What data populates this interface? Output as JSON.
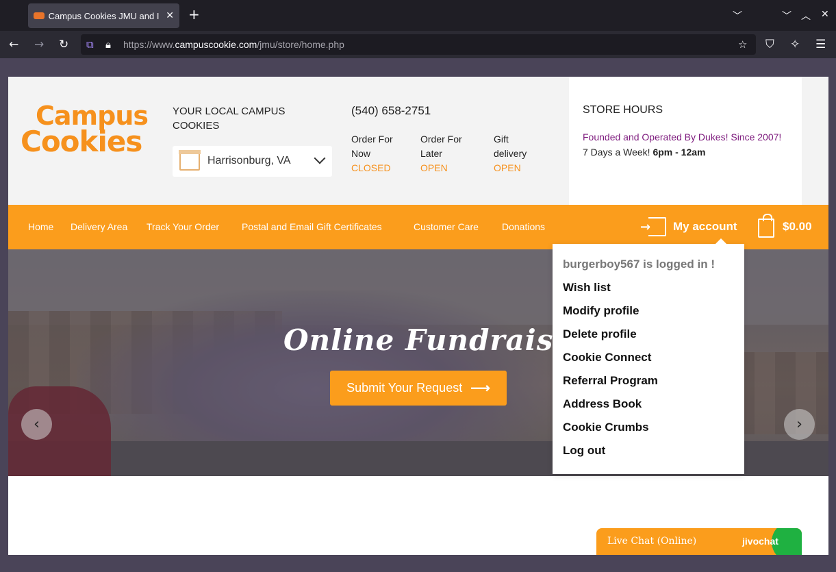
{
  "browser": {
    "tab_title": "Campus Cookies JMU and I",
    "url_prefix": "https://www.",
    "url_domain": "campuscookie.com",
    "url_path": "/jmu/store/home.php"
  },
  "header": {
    "logo_line1": "Campus",
    "logo_line2": "Cookies",
    "local_label": "YOUR LOCAL CAMPUS COOKIES",
    "location": "Harrisonburg, VA",
    "phone": "(540) 658-2751",
    "order_options": [
      {
        "label": "Order For Now",
        "status": "CLOSED"
      },
      {
        "label": "Order For Later",
        "status": "OPEN"
      },
      {
        "label": "Gift delivery",
        "status": "OPEN"
      }
    ],
    "hours_title": "STORE HOURS",
    "founded": "Founded and Operated By Dukes! Since 2007!",
    "days_prefix": "7 Days a Week!",
    "days_time": "6pm - 12am"
  },
  "nav": {
    "items": [
      "Home",
      "Delivery Area",
      "Track Your Order",
      "Postal and Email Gift Certificates",
      "Customer Care",
      "Donations"
    ],
    "account_label": "My account",
    "cart_total": "$0.00"
  },
  "hero": {
    "title": "Online Fundraisers",
    "button": "Submit Your Request"
  },
  "account_menu": {
    "logged_in": "burgerboy567 is logged in !",
    "items": [
      "Wish list",
      "Modify profile",
      "Delete profile",
      "Cookie Connect",
      "Referral Program",
      "Address Book",
      "Cookie Crumbs",
      "Log out"
    ]
  },
  "chat": {
    "label": "Live Chat (Online)",
    "brand": "jivochat"
  }
}
